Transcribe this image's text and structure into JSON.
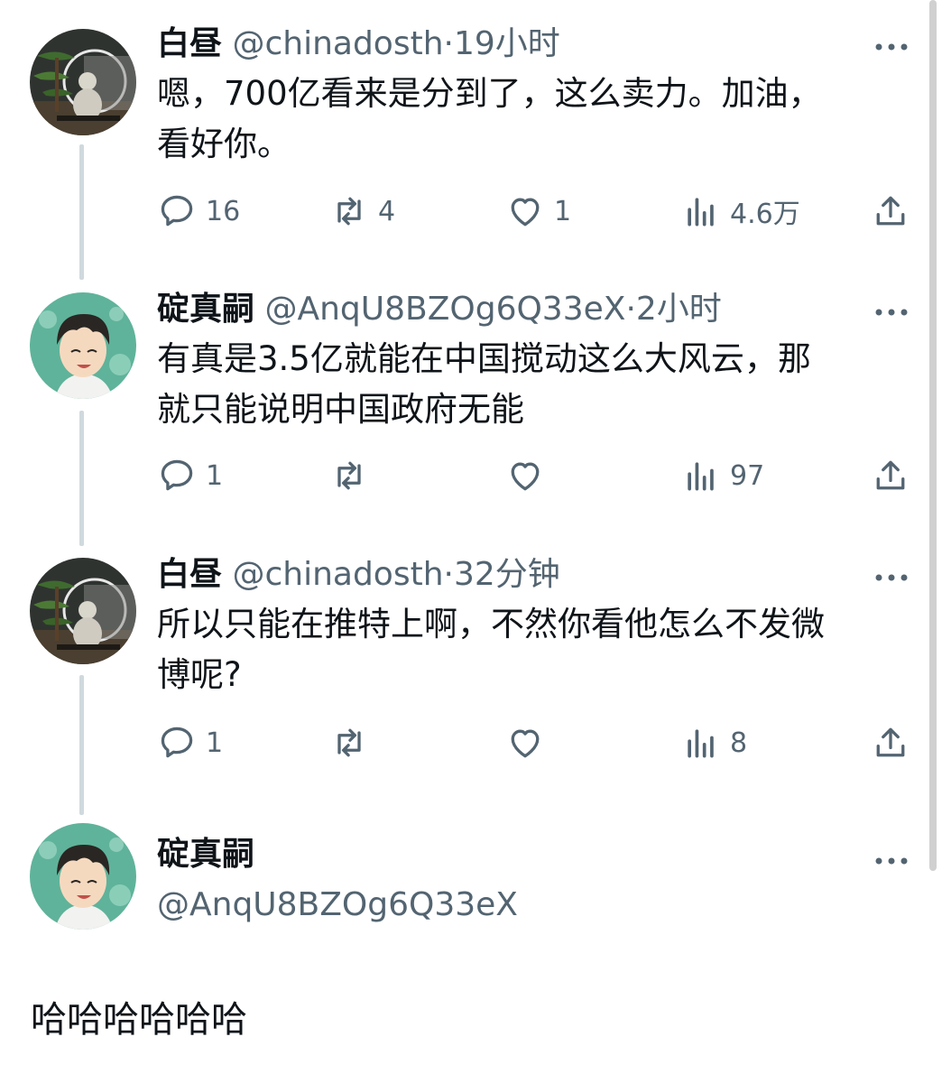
{
  "tweets": [
    {
      "name": "白昼",
      "handle": "@chinadosth",
      "dot": "·",
      "time": "19小时",
      "line1": "嗯，700亿看来是分到了，这么卖力。加油，",
      "line2": "看好你。",
      "replies": "16",
      "retweets": "4",
      "likes": "1",
      "views": "4.6万"
    },
    {
      "name": "碇真嗣",
      "handle": "@AnqU8BZOg6Q33eX",
      "dot": "·",
      "time": "2小时",
      "line1": "有真是3.5亿就能在中国搅动这么大风云，那",
      "line2": "就只能说明中国政府无能",
      "replies": "1",
      "retweets": "",
      "likes": "",
      "views": "97"
    },
    {
      "name": "白昼",
      "handle": "@chinadosth",
      "dot": "·",
      "time": "32分钟",
      "line1": "所以只能在推特上啊，不然你看他怎么不发微",
      "line2": "博呢?",
      "replies": "1",
      "retweets": "",
      "likes": "",
      "views": "8"
    }
  ],
  "reply_compose": {
    "name": "碇真嗣",
    "handle": "@AnqU8BZOg6Q33eX",
    "text": "哈哈哈哈哈哈"
  },
  "icons": [
    "reply-icon",
    "retweet-icon",
    "like-icon",
    "views-icon",
    "share-icon",
    "more-icon"
  ],
  "colors": {
    "text": "#0f1419",
    "muted": "#536471",
    "thread": "#cfd9de"
  }
}
